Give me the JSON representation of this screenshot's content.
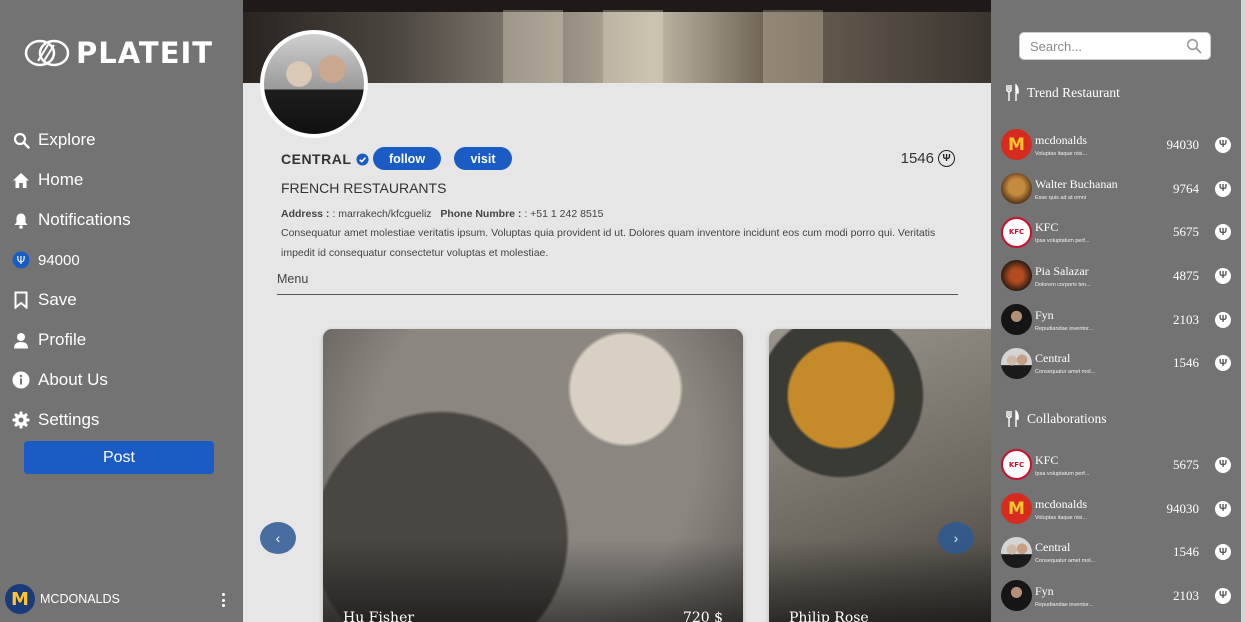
{
  "brand": {
    "name": "PLATEIT"
  },
  "sidebar": {
    "items": [
      {
        "label": "Explore",
        "icon": "search-icon"
      },
      {
        "label": "Home",
        "icon": "home-icon"
      },
      {
        "label": "Notifications",
        "icon": "bell-icon"
      },
      {
        "label": "94000",
        "icon": "coin-icon"
      },
      {
        "label": "Save",
        "icon": "bookmark-icon"
      },
      {
        "label": "Profile",
        "icon": "user-icon"
      },
      {
        "label": "About Us",
        "icon": "info-icon"
      },
      {
        "label": "Settings",
        "icon": "gear-icon"
      }
    ],
    "post_label": "Post",
    "account_name": "MCDONALDS",
    "account_logo": "M"
  },
  "profile": {
    "name": "CENTRAL",
    "follow_label": "follow",
    "visit_label": "visit",
    "points": "1546",
    "coin_symbol": "Ψ",
    "category": "FRENCH RESTAURANTS",
    "address_label": "Address : ",
    "address_value": ": marrakech/kfcgueliz",
    "phone_label": "Phone Numbre : ",
    "phone_value": ": +51 1 242 8515",
    "description": "Consequatur amet molestiae veritatis ipsum. Voluptas quia provident id ut. Dolores quam inventore incidunt eos cum modi porro qui. Veritatis impedit id consequatur consectetur voluptas et molestiae.",
    "menu_tab": "Menu"
  },
  "cards": [
    {
      "name": "Hu Fisher",
      "price": "720 $"
    },
    {
      "name": "Philip Rose",
      "price": ""
    }
  ],
  "carousel": {
    "prev": "‹",
    "next": "›"
  },
  "search": {
    "placeholder": "Search..."
  },
  "trend": {
    "title": "Trend Restaurant",
    "items": [
      {
        "name": "mcdonalds",
        "sub": "Voluptas itaque nisi...",
        "score": "94030",
        "logo": "M",
        "av": "mc"
      },
      {
        "name": "Walter Buchanan",
        "sub": "Esse quis ad at omni",
        "score": "9764",
        "logo": "",
        "av": "walter"
      },
      {
        "name": "KFC",
        "sub": "Ipsa voluptatum perf...",
        "score": "5675",
        "logo": "KFC",
        "av": "kfc"
      },
      {
        "name": "Pia Salazar",
        "sub": "Dolorem corporis ten...",
        "score": "4875",
        "logo": "",
        "av": "pia"
      },
      {
        "name": "Fyn",
        "sub": "Repudiandae inventor...",
        "score": "2103",
        "logo": "",
        "av": "fyn"
      },
      {
        "name": "Central",
        "sub": "Consequatur amet mol...",
        "score": "1546",
        "logo": "",
        "av": "central"
      }
    ]
  },
  "collabs": {
    "title": "Collaborations",
    "items": [
      {
        "name": "KFC",
        "sub": "Ipsa voluptatum perf...",
        "score": "5675",
        "logo": "KFC",
        "av": "kfc"
      },
      {
        "name": "mcdonalds",
        "sub": "Voluptas itaque nisi...",
        "score": "94030",
        "logo": "M",
        "av": "mc"
      },
      {
        "name": "Central",
        "sub": "Consequatur amet mol...",
        "score": "1546",
        "logo": "",
        "av": "central"
      },
      {
        "name": "Fyn",
        "sub": "Repudiandae inventor...",
        "score": "2103",
        "logo": "",
        "av": "fyn"
      }
    ]
  },
  "colors": {
    "accent": "#1a5bc4",
    "sidebar_bg": "#737373",
    "main_bg": "#e6e6e6",
    "mcdonalds_yellow": "#ffc72c",
    "kfc_red": "#c8102e"
  }
}
